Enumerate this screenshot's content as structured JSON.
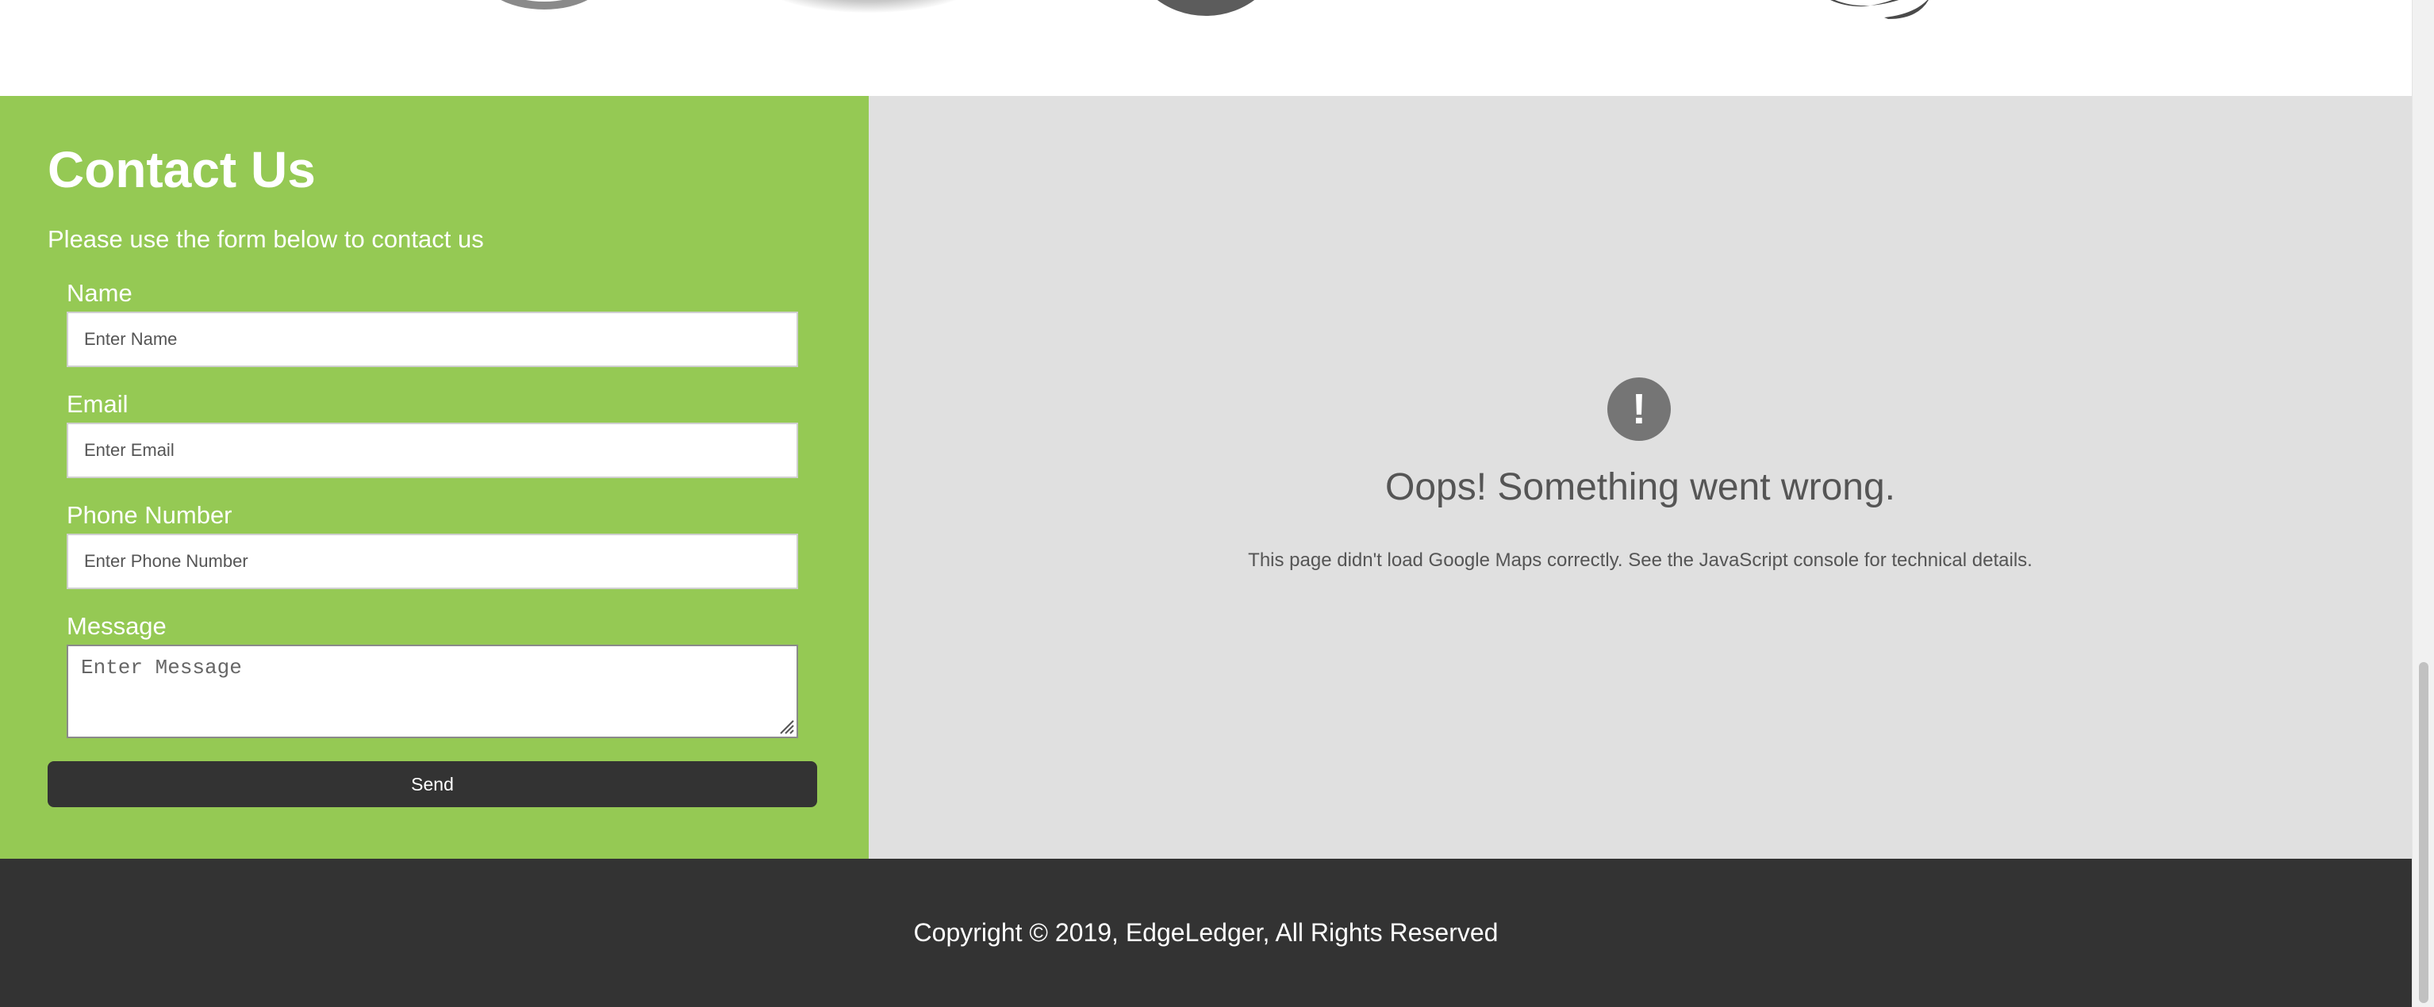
{
  "partner_logos": [
    "circle-logo-icon",
    "disc-logo-icon",
    "sphere-logo-icon",
    "swoosh-logo-icon"
  ],
  "contact": {
    "title": "Contact Us",
    "subtitle": "Please use the form below to contact us",
    "fields": {
      "name": {
        "label": "Name",
        "placeholder": "Enter Name",
        "value": ""
      },
      "email": {
        "label": "Email",
        "placeholder": "Enter Email",
        "value": ""
      },
      "phone": {
        "label": "Phone Number",
        "placeholder": "Enter Phone Number",
        "value": ""
      },
      "message": {
        "label": "Message",
        "placeholder": "Enter Message",
        "value": ""
      }
    },
    "send_label": "Send"
  },
  "map": {
    "error_icon_glyph": "!",
    "error_title": "Oops! Something went wrong.",
    "error_detail": "This page didn't load Google Maps correctly. See the JavaScript console for technical details."
  },
  "footer": {
    "copyright": "Copyright © 2019, EdgeLedger, All Rights Reserved"
  },
  "colors": {
    "contact_bg": "#95c954",
    "map_bg": "#e0e0e0",
    "footer_bg": "#333333",
    "button_bg": "#333333",
    "error_icon_bg": "#757575",
    "text_on_dark": "#ffffff"
  }
}
